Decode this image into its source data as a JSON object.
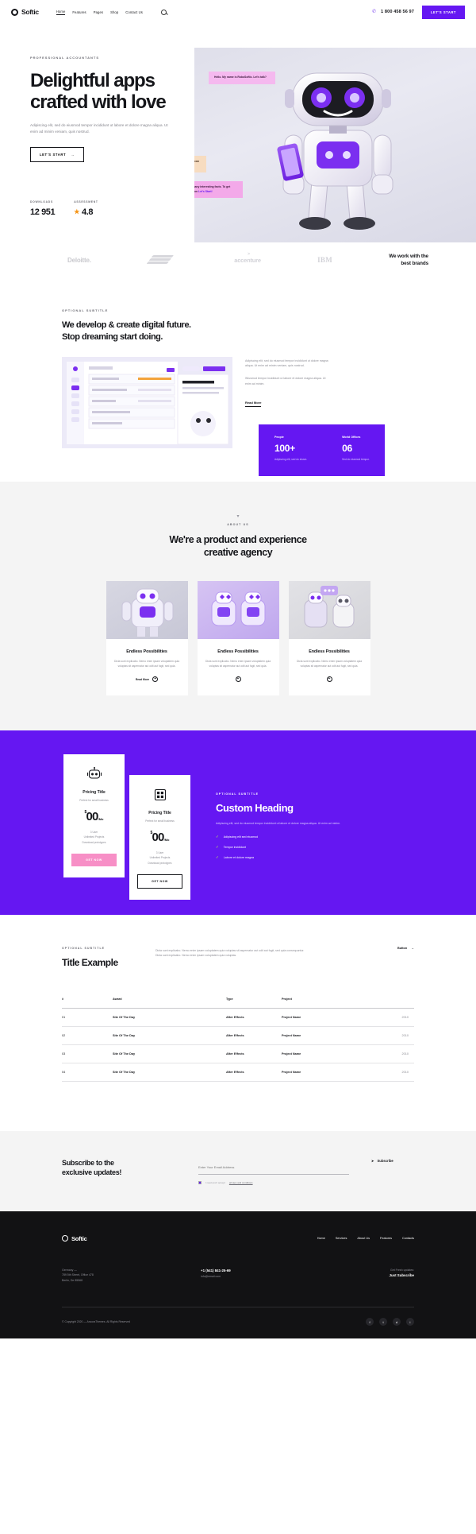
{
  "header": {
    "logo": "Softic",
    "nav": [
      {
        "label": "Home",
        "active": true
      },
      {
        "label": "Features",
        "active": false
      },
      {
        "label": "Pages",
        "active": false
      },
      {
        "label": "Shop",
        "active": false
      },
      {
        "label": "Contact Us",
        "active": false
      }
    ],
    "search_icon": "search-icon",
    "phone_icon": "phone-icon",
    "phone": "1 800 458 56 97",
    "cta": "LET'S START",
    "accent": "#6517f2"
  },
  "hero": {
    "eyebrow": "PROFESSIONAL ACCOUNTANTS",
    "title_line1": "Delightful apps",
    "title_line2": "crafted with love",
    "paragraph": "Adipiscing elit, sed do eiusmod tempor incididunt ut labore et dolore magna aliqua. Ut enim ad minim veniam, quis nostrud.",
    "cta": "LET'S START",
    "cta_arrow": "→",
    "stats": [
      {
        "label": "DOWNLOADS",
        "value": "12 951",
        "star": false
      },
      {
        "label": "ASSESSMENT",
        "value": "4.8",
        "star": true
      }
    ],
    "bubbles": [
      {
        "id": "bubble-1",
        "text": "Hello. My name is RoboSoftic. Let's talk?",
        "color": "#f5b9ef"
      },
      {
        "id": "bubble-2",
        "text": "Hey RoboSoftic. Tell me what can you do?",
        "color": "#f7dcc0"
      },
      {
        "id": "bubble-3",
        "text": "I can tell you many interesting facts. To get samples, click on ",
        "link": "Let's Start!",
        "color": "#f3a9e9"
      }
    ]
  },
  "brands": {
    "items": [
      "Deloitte.",
      "bank-of-america-logo",
      "accenture",
      "IBM"
    ],
    "note_line1": "We work with the",
    "note_line2": "best brands"
  },
  "develop": {
    "eyebrow": "OPTIONAL SUBTITLE",
    "title_line1": "We develop & create digital future.",
    "title_line2": "Stop dreaming start doing.",
    "para1": "Adipiscing elit, sed do eiusmod tempor incididunt ut dolore magna aliqua. Ut enim ad minim veniam, quis nostrud.",
    "para2": "Wiusmod tempor incididunt ut labore et dolore magna aliqua. Ut enim ad minim.",
    "read_more": "Read More",
    "band": [
      {
        "label": "People",
        "value": "100+",
        "desc": "Adipiscing elit, sed do eiusm."
      },
      {
        "label": "World Offices",
        "value": "06",
        "desc": "Sed do eiusmod tempor."
      }
    ]
  },
  "about": {
    "arrow": "▾",
    "eyebrow": "ABOUT US",
    "title_line1": "We're a product and experience",
    "title_line2": "creative agency",
    "cards": [
      {
        "title": "Endless Possibilities",
        "desc": "Dicta sunt explicabo. Nemo enim ipsam voluptatem quia voluptas sit aspernatur aut odit aut fugit, sed quia.",
        "link": "Read More",
        "icon": "plus-icon"
      },
      {
        "title": "Endless Possibilities",
        "desc": "Dicta sunt explicabo. Nemo enim ipsam voluptatem quia voluptas sit aspernatur aut odit aut fugit, sed quia.",
        "link": "",
        "icon": "plus-icon"
      },
      {
        "title": "Endless Possibilities",
        "desc": "Dicta sunt explicabo. Nemo enim ipsam voluptatem quia voluptas sit aspernatur aut odit aut fugit, sed quia.",
        "link": "",
        "icon": "plus-icon"
      }
    ]
  },
  "pricing": {
    "cards": [
      {
        "icon": "robot-icon",
        "title": "Pricing Title",
        "sub": "Perfect for small business",
        "currency": "$",
        "price": "00",
        "period": "/Mo",
        "features": [
          "3 User",
          "Unlimited Projects",
          "Download prototypes"
        ],
        "button": "GET NOW",
        "button_style": "pink"
      },
      {
        "icon": "grid-robot-icon",
        "title": "Pricing Title",
        "sub": "Perfect for small business",
        "currency": "$",
        "price": "00",
        "period": "/Mo",
        "features": [
          "3 User",
          "Unlimited Projects",
          "Download prototypes"
        ],
        "button": "GET NOW",
        "button_style": "dark"
      }
    ],
    "eyebrow": "OPTIONAL SUBTITLE",
    "heading": "Custom Heading",
    "paragraph": "Adipiscing elit, sed do eiusmod tempor incididunt ut labore et dolore magna aliqua. Ut enim ad minim.",
    "list": [
      "Adipiscing elit sed eiusmod",
      "Tempor incididunt",
      "Labore et dolore magna"
    ]
  },
  "table_section": {
    "eyebrow": "OPTIONAL SUBTITLE",
    "title": "Title Example",
    "desc": "Dicta sunt explicabo. Nemo enim ipsam voluptatem quia voluptas sit aspernatur aut odit aut fugit, sed quia consequuntur. Dicta sunt explicabo. Nemo enim ipsam voluptatem quia voluptas.",
    "button": "Button",
    "button_arrow": "→",
    "columns": [
      "#",
      "Award",
      "Type",
      "Project",
      ""
    ],
    "rows": [
      {
        "num": "01",
        "award": "Site Of The Day",
        "type": "After Effects",
        "project": "Project Name",
        "year": "2010"
      },
      {
        "num": "02",
        "award": "Site Of The Day",
        "type": "After Effects",
        "project": "Project Name",
        "year": "2010"
      },
      {
        "num": "03",
        "award": "Site Of The Day",
        "type": "After Effects",
        "project": "Project Name",
        "year": "2010"
      },
      {
        "num": "04",
        "award": "Site Of The Day",
        "type": "After Effects",
        "project": "Project Name",
        "year": "2010"
      }
    ]
  },
  "subscribe": {
    "title_line1": "Subscribe to the",
    "title_line2": "exclusive updates!",
    "placeholder": "Enter Your Email Address",
    "consent": "I read and I accept ",
    "consent_link": "privacy and conditions",
    "button": "Subscribe",
    "button_icon": "send-icon"
  },
  "footer": {
    "logo": "Softic",
    "nav": [
      "Home",
      "Services",
      "About Us",
      "Features",
      "Contacts"
    ],
    "address_label": "Germany —",
    "address_line1": "789 5th Street, Office 478",
    "address_line2": "Berlin, De 85568",
    "phone": "+1 (541) 841-25-69",
    "email": "info@email.com",
    "get_fresh": "Get Fresh updates:",
    "just_subscribe": "Just Subscribe",
    "copyright": "© Copyright 2020 — AncoraThemes. All Rights Reserved",
    "social": [
      "facebook-icon",
      "twitter-icon",
      "dribbble-icon",
      "instagram-icon"
    ]
  }
}
